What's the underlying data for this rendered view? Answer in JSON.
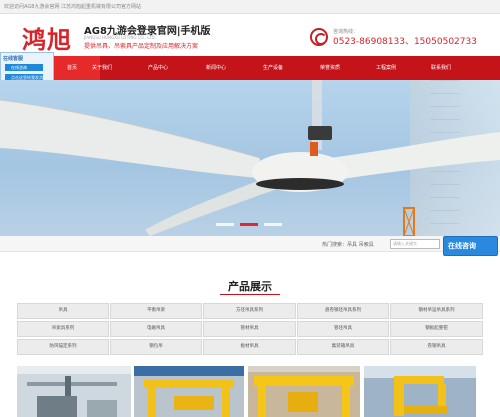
{
  "topbar": {
    "welcome": "欢迎访问AG8九游会官网·江苏鸿旭起重机械有限公司官方网站"
  },
  "header": {
    "logo": "鸿旭",
    "company_name": "AG8九游会登录官网|手机版",
    "company_en": "JIANGSU HONGXU LIFTING CO., LTD.",
    "slogan": "提供吊具、吊索具产品定制及应用解决方案",
    "hotline_label": "咨询热线：",
    "hotline_number": "0523-86908133、15050502733"
  },
  "nav": {
    "items": [
      {
        "label": "首页",
        "active": true
      },
      {
        "label": "关于我们",
        "active": false
      },
      {
        "label": "产品中心",
        "active": false
      },
      {
        "label": "新闻中心",
        "active": false
      },
      {
        "label": "生产设备",
        "active": false
      },
      {
        "label": "荣誉资质",
        "active": false
      },
      {
        "label": "工程案例",
        "active": false
      },
      {
        "label": "联系我们",
        "active": false
      }
    ]
  },
  "float_panel": {
    "title": "在线客服",
    "buttons": [
      "在线咨询",
      "点击这里给我发消息"
    ]
  },
  "banner": {
    "slide_count": 3,
    "active_slide": 2
  },
  "search": {
    "hotwords": "热门搜索：吊具 吊索具",
    "placeholder": "请输入关键字"
  },
  "online_chat": {
    "label": "在线咨询"
  },
  "products_section": {
    "title": "产品展示",
    "categories": [
      [
        "吊具",
        "平衡吊梁",
        "方坯吊具系列",
        "盘卷钢坯吊具系列",
        "钢材吊运吊具系列"
      ],
      [
        "吊索具系列",
        "电磁吊具",
        "管材吊具",
        "管坯吊具",
        "钢板起重钳"
      ],
      [
        "防风锚定系列",
        "钢包吊",
        "板材吊具",
        "集装箱吊具",
        "卷钢吊具"
      ]
    ],
    "product_images": [
      "海上风电吊具",
      "箱式吊具",
      "C型吊具",
      "卷钢吊具"
    ]
  }
}
